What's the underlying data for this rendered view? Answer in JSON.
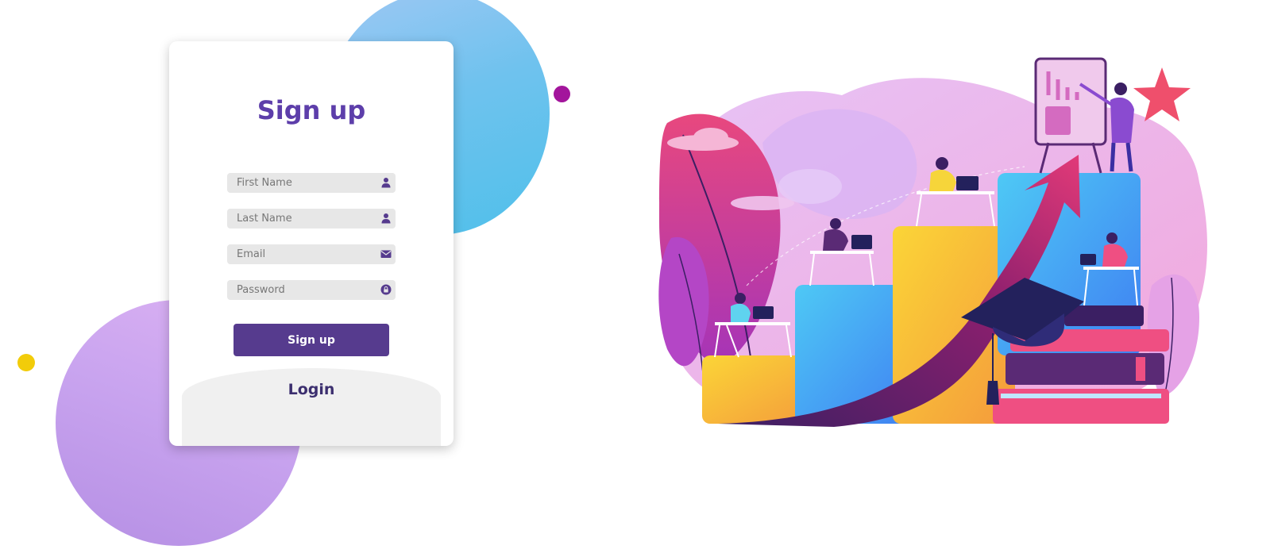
{
  "signup": {
    "title": "Sign up",
    "fields": [
      {
        "placeholder": "First Name",
        "icon": "user-icon"
      },
      {
        "placeholder": "Last Name",
        "icon": "user-icon"
      },
      {
        "placeholder": "Email",
        "icon": "envelope-icon"
      },
      {
        "placeholder": "Password",
        "icon": "lock-icon"
      }
    ],
    "submit_label": "Sign up",
    "login_label": "Login"
  },
  "colors": {
    "brand": "#563b8e",
    "title": "#5d3eaa",
    "field_bg": "#e7e7e7",
    "login_bg": "#f0f0f0",
    "accent_dot": "#a3159c",
    "yellow_dot": "#f2cc0a"
  },
  "illustration": {
    "subject": "growth-education-illustration"
  }
}
